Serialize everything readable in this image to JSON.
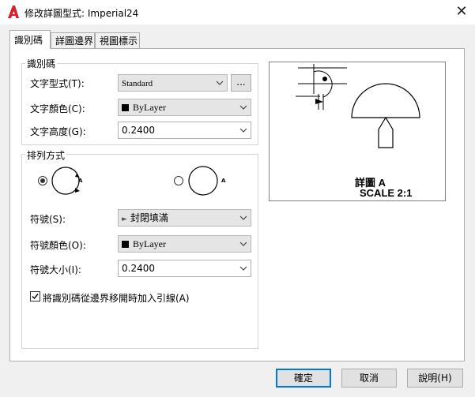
{
  "window": {
    "title": "修改詳圖型式: Imperial24",
    "close_glyph": "✕"
  },
  "tabs": [
    {
      "label": "識別碼",
      "active": true
    },
    {
      "label": "詳圖邊界",
      "active": false
    },
    {
      "label": "視圖標示",
      "active": false
    }
  ],
  "identifier": {
    "group_title": "識別碼",
    "text_style": {
      "label": "文字型式(T):",
      "value": "Standard",
      "browse_label": "..."
    },
    "text_color": {
      "label": "文字顏色(C):",
      "value": "ByLayer"
    },
    "text_height": {
      "label": "文字高度(G):",
      "value": "0.2400"
    }
  },
  "arrangement": {
    "group_title": "排列方式",
    "option1_letter": "A",
    "option2_letter": "A",
    "selected_option": 1,
    "symbol": {
      "label": "符號(S):",
      "value": "封閉填滿",
      "arrow_glyph": "►"
    },
    "symbol_color": {
      "label": "符號顏色(O):",
      "value": "ByLayer"
    },
    "symbol_size": {
      "label": "符號大小(I):",
      "value": "0.2400"
    },
    "leader_checkbox": {
      "label": "將識別碼從邊界移開時加入引線(A)",
      "checked": true
    }
  },
  "preview": {
    "line1": "詳圖 A",
    "line2": "SCALE 2:1"
  },
  "buttons": {
    "ok": "確定",
    "cancel": "取消",
    "help": "說明(H)"
  },
  "colors": {
    "accent": "#0078d7",
    "app_icon": "#d3222a"
  }
}
